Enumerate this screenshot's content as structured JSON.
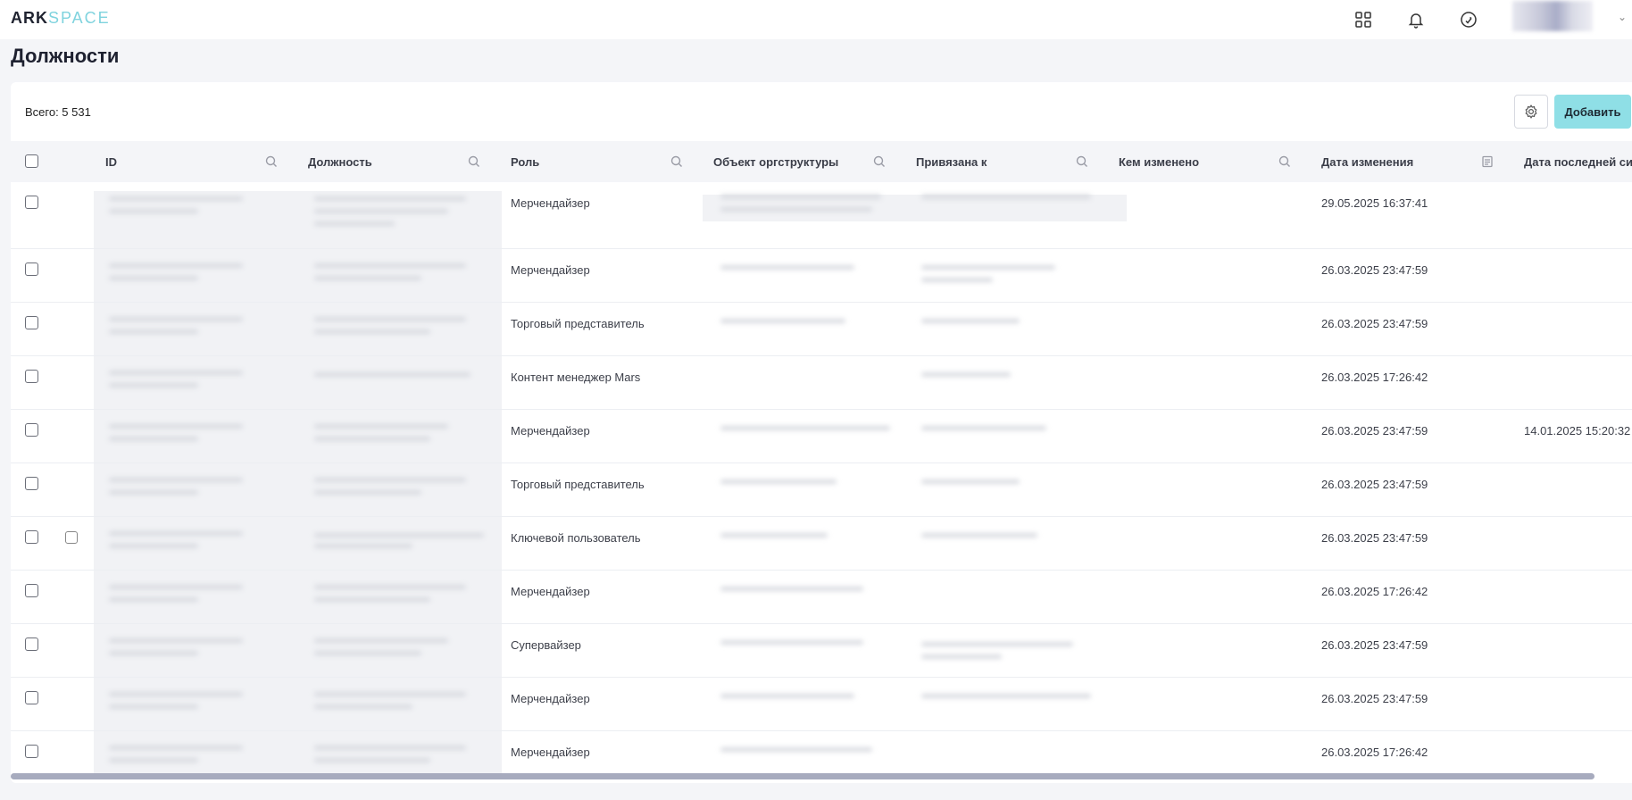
{
  "app": {
    "logo_ark": "ARK",
    "logo_space": "SPACE",
    "icons": [
      "apps-grid-icon",
      "bell-icon",
      "sync-icon"
    ]
  },
  "page": {
    "title": "Должности",
    "total_label": "Всего: 5 531",
    "add_label": "Добавить"
  },
  "table": {
    "columns": [
      {
        "key": "id",
        "label": "ID",
        "icon": "search-icon"
      },
      {
        "key": "position",
        "label": "Должность",
        "icon": "search-icon"
      },
      {
        "key": "role",
        "label": "Роль",
        "icon": "search-icon"
      },
      {
        "key": "org",
        "label": "Объект оргструктуры",
        "icon": "search-icon"
      },
      {
        "key": "bound",
        "label": "Привязана к",
        "icon": "search-icon"
      },
      {
        "key": "changed_by",
        "label": "Кем изменено",
        "icon": "search-icon"
      },
      {
        "key": "changed_at",
        "label": "Дата изменения",
        "icon": "calendar-icon"
      },
      {
        "key": "last_sync",
        "label": "Дата последней си"
      }
    ],
    "rows": [
      {
        "role": "Мерчендайзер",
        "changed_at": "29.05.2025 16:37:41",
        "last_sync": ""
      },
      {
        "role": "Мерчендайзер",
        "changed_at": "26.03.2025 23:47:59",
        "last_sync": ""
      },
      {
        "role": "Торговый представитель",
        "changed_at": "26.03.2025 23:47:59",
        "last_sync": ""
      },
      {
        "role": "Контент менеджер Mars",
        "changed_at": "26.03.2025 17:26:42",
        "last_sync": ""
      },
      {
        "role": "Мерчендайзер",
        "changed_at": "26.03.2025 23:47:59",
        "last_sync": "14.01.2025 15:20:32"
      },
      {
        "role": "Торговый представитель",
        "changed_at": "26.03.2025 23:47:59",
        "last_sync": ""
      },
      {
        "role": "Ключевой пользователь",
        "changed_at": "26.03.2025 23:47:59",
        "last_sync": "",
        "has_icon": true
      },
      {
        "role": "Мерчендайзер",
        "changed_at": "26.03.2025 17:26:42",
        "last_sync": ""
      },
      {
        "role": "Супервайзер",
        "changed_at": "26.03.2025 23:47:59",
        "last_sync": ""
      },
      {
        "role": "Мерчендайзер",
        "changed_at": "26.03.2025 23:47:59",
        "last_sync": ""
      },
      {
        "role": "Мерчендайзер",
        "changed_at": "26.03.2025 17:26:42",
        "last_sync": ""
      }
    ]
  }
}
